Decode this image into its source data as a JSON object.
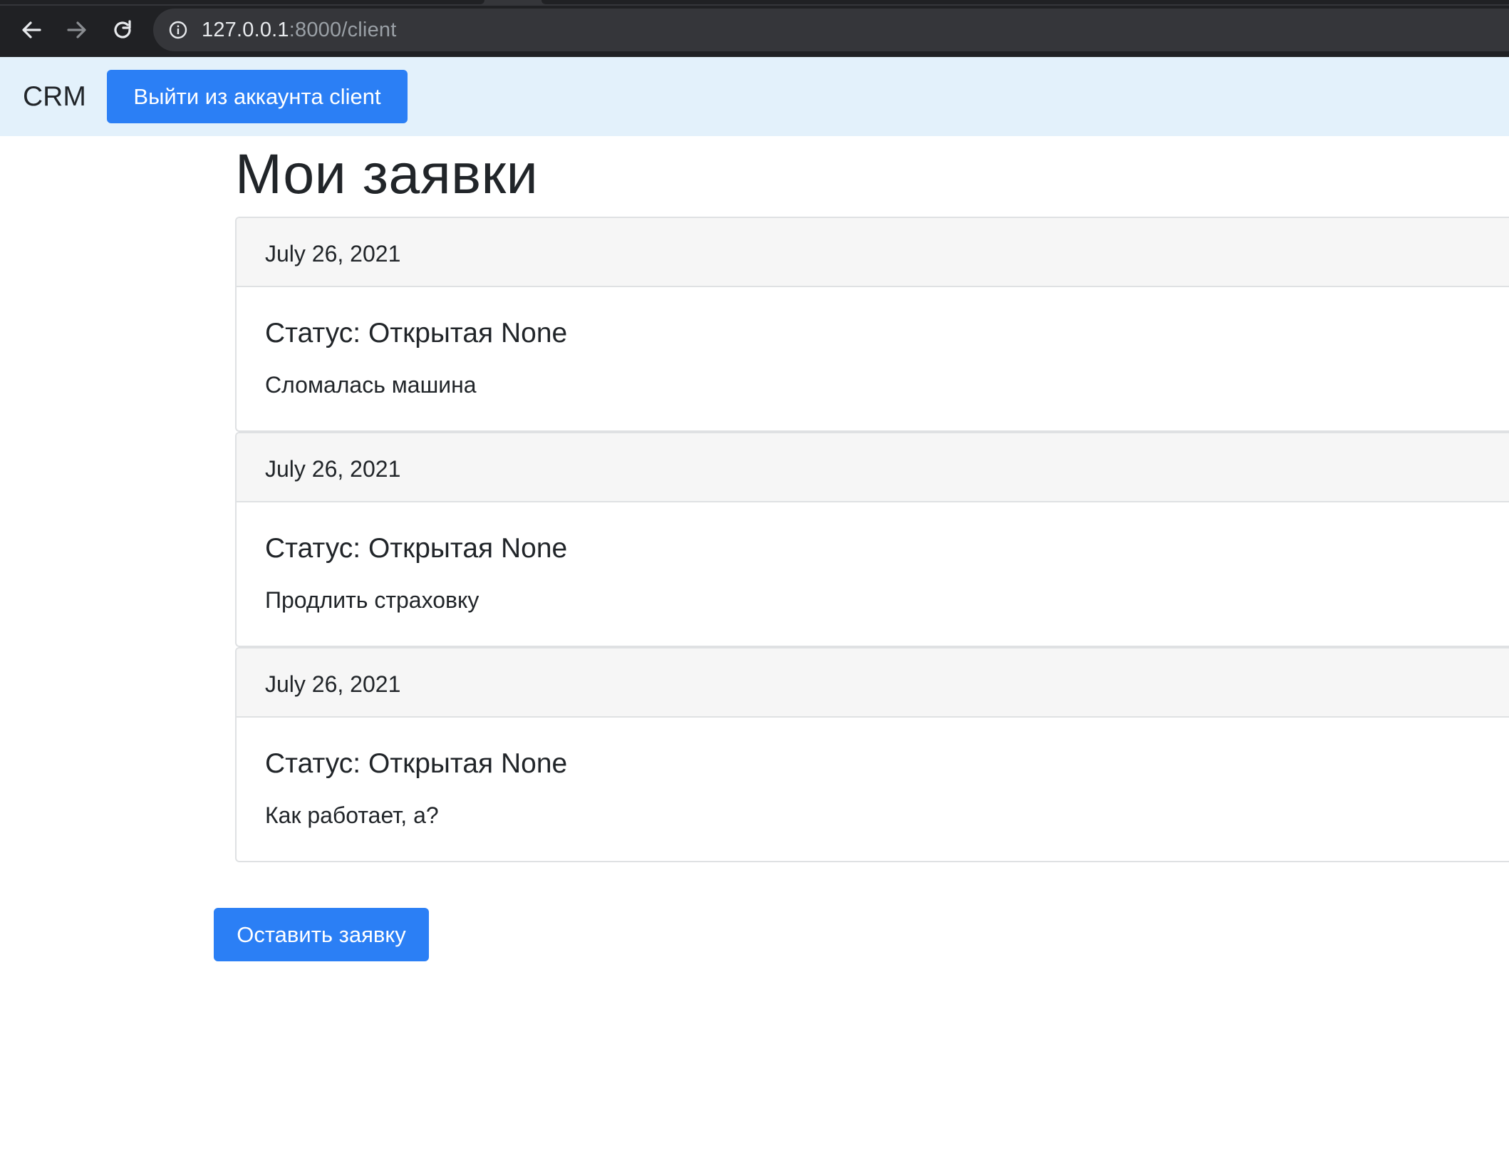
{
  "browser": {
    "url_host": "127.0.0.1",
    "url_path": ":8000/client"
  },
  "navbar": {
    "brand": "CRM",
    "logout_label": "Выйти из аккаунта client"
  },
  "page": {
    "title": "Мои заявки"
  },
  "requests": [
    {
      "date": "July 26, 2021",
      "status": "Статус: Открытая None",
      "text": "Сломалась машина"
    },
    {
      "date": "July 26, 2021",
      "status": "Статус: Открытая None",
      "text": "Продлить страховку"
    },
    {
      "date": "July 26, 2021",
      "status": "Статус: Открытая None",
      "text": "Как работает, а?"
    }
  ],
  "actions": {
    "create_label": "Оставить заявку"
  },
  "colors": {
    "primary": "#2b7ff5",
    "navbar_bg": "#e3f1fb",
    "chrome_bg": "#202124"
  }
}
